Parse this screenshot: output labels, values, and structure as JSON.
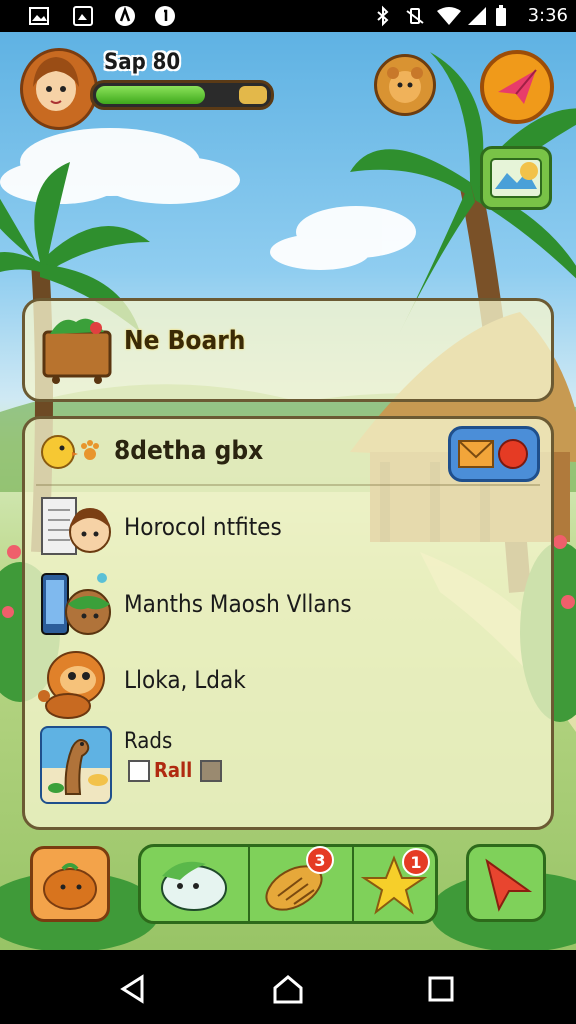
{
  "status_bar": {
    "time": "3:36",
    "left_icons": [
      "image-icon",
      "photo-icon",
      "app-icon",
      "notification-icon"
    ],
    "right_icons": [
      "bluetooth-icon",
      "vibrate-icon",
      "wifi-icon",
      "signal-icon",
      "battery-icon"
    ]
  },
  "player": {
    "name": "Sap 80",
    "health_fraction": 0.75
  },
  "top_buttons": {
    "pet": "pet-icon",
    "send": "paper-plane-icon",
    "map": "map-icon"
  },
  "board": {
    "title": "Ne Boarh",
    "icon": "crate-icon"
  },
  "list": {
    "title": "8detha gbx",
    "title_icons": [
      "chick-icon",
      "paw-icon"
    ],
    "header_button_icon": "mail-icon",
    "rows": [
      {
        "label": "Horocol ntfites",
        "icon": "character-with-paper-icon"
      },
      {
        "label": "Manths Maosh Vllans",
        "icon": "phone-monster-icon"
      },
      {
        "label": "Lloka, Ldak",
        "icon": "orange-creature-icon"
      },
      {
        "label": "Rads",
        "icon": "creature-card-icon",
        "checkbox_label": "Rall"
      }
    ]
  },
  "dock": {
    "left": "pumpkin-icon",
    "group": [
      {
        "icon": "green-pet-icon"
      },
      {
        "icon": "bread-icon",
        "badge": "3"
      },
      {
        "icon": "star-icon",
        "badge": "1"
      }
    ],
    "right": "arrow-icon"
  },
  "nav_bar": [
    "back-icon",
    "home-icon",
    "recents-icon"
  ],
  "colors": {
    "health": "#4cc12a",
    "panel_border": "#6b5a33",
    "badge": "#e53b24",
    "dock_green": "#7fd15a"
  }
}
